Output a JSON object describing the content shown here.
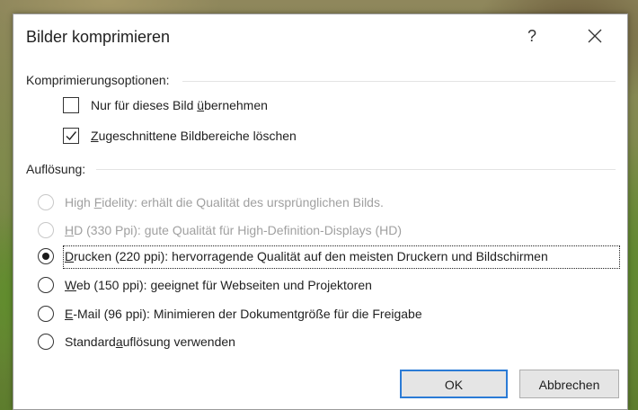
{
  "dialog": {
    "title": "Bilder komprimieren",
    "help_label": "?",
    "close_icon": "close-icon"
  },
  "compression": {
    "heading": "Komprimierungsoptionen:",
    "options": [
      {
        "pre": "Nur für dieses Bild ",
        "accel": "ü",
        "post": "bernehmen",
        "checked": false
      },
      {
        "pre": "",
        "accel": "Z",
        "post": "ugeschnittene Bildbereiche löschen",
        "checked": true
      }
    ]
  },
  "resolution": {
    "heading": "Auflösung:",
    "options": [
      {
        "pre": "High ",
        "accel": "F",
        "post": "idelity: erhält die Qualität des ursprünglichen Bilds.",
        "enabled": false,
        "selected": false
      },
      {
        "pre": "",
        "accel": "H",
        "post": "D (330 Ppi): gute Qualität für High-Definition-Displays (HD)",
        "enabled": false,
        "selected": false
      },
      {
        "pre": "",
        "accel": "D",
        "post": "rucken (220 ppi): hervorragende Qualität auf den meisten Druckern und Bildschirmen",
        "enabled": true,
        "selected": true
      },
      {
        "pre": "",
        "accel": "W",
        "post": "eb (150 ppi): geeignet für Webseiten und Projektoren",
        "enabled": true,
        "selected": false
      },
      {
        "pre": "",
        "accel": "E",
        "post": "-Mail (96 ppi): Minimieren der Dokumentgröße für die Freigabe",
        "enabled": true,
        "selected": false
      },
      {
        "pre": "Standard",
        "accel": "a",
        "post": "uflösung verwenden",
        "enabled": true,
        "selected": false
      }
    ]
  },
  "buttons": {
    "ok": "OK",
    "cancel": "Abbrechen"
  },
  "colors": {
    "accent": "#2b7bd6",
    "disabled_text": "#a0a0a0"
  }
}
